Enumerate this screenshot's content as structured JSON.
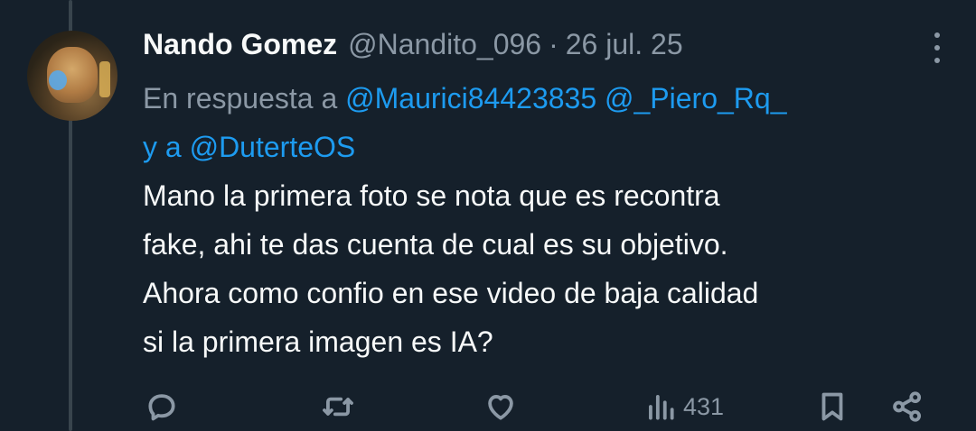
{
  "tweet": {
    "author_name": "Nando Gomez",
    "handle": "@Nandito_096",
    "separator": "·",
    "date": "26 jul. 25",
    "reply_prefix": "En respuesta a",
    "mentions": [
      "@Maurici84423835",
      "@_Piero_Rq_",
      "@DuterteOS"
    ],
    "mention_joiner": "y a",
    "body_lines": [
      "Mano la primera foto se nota que es recontra",
      "fake, ahi te das cuenta de cual es su objetivo.",
      "Ahora como confio en ese video de baja calidad",
      "si la primera imagen es IA?"
    ]
  },
  "actions": {
    "reply_icon": "reply-icon",
    "retweet_icon": "retweet-icon",
    "like_icon": "heart-icon",
    "views_icon": "views-icon",
    "views_count": "431",
    "bookmark_icon": "bookmark-icon",
    "share_icon": "share-icon"
  },
  "colors": {
    "background": "#15202b",
    "text_primary": "#f7f9f9",
    "text_secondary": "#8b98a5",
    "mention": "#1d9bf0"
  }
}
